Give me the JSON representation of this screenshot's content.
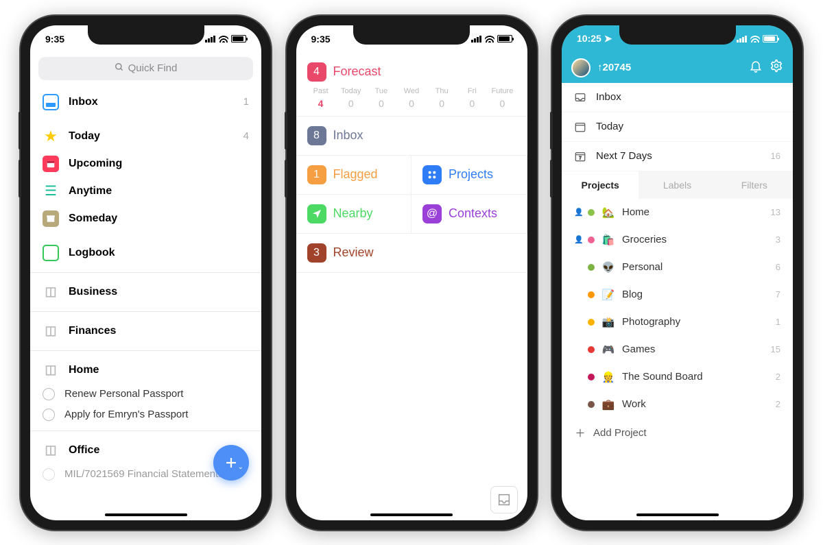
{
  "phone1": {
    "time": "9:35",
    "search_placeholder": "Quick Find",
    "items": [
      {
        "label": "Inbox",
        "count": "1"
      },
      {
        "label": "Today",
        "count": "4"
      },
      {
        "label": "Upcoming",
        "count": ""
      },
      {
        "label": "Anytime",
        "count": ""
      },
      {
        "label": "Someday",
        "count": ""
      },
      {
        "label": "Logbook",
        "count": ""
      }
    ],
    "areas": [
      "Business",
      "Finances",
      "Home",
      "Office"
    ],
    "tasks": [
      "Renew Personal Passport",
      "Apply for Emryn's Passport"
    ],
    "cutoff_task": "MIL/7021569 Financial Statements"
  },
  "phone2": {
    "time": "9:35",
    "forecast": {
      "badge": "4",
      "label": "Forecast",
      "color": "#e9486a"
    },
    "days": [
      {
        "h": "Past",
        "v": "4",
        "active": true
      },
      {
        "h": "Today",
        "v": "0"
      },
      {
        "h": "Tue",
        "v": "0"
      },
      {
        "h": "Wed",
        "v": "0"
      },
      {
        "h": "Thu",
        "v": "0"
      },
      {
        "h": "Fri",
        "v": "0"
      },
      {
        "h": "Future",
        "v": "0"
      }
    ],
    "inbox": {
      "badge": "8",
      "label": "Inbox",
      "badge_color": "#6d7896",
      "text_color": "#6d7896"
    },
    "flagged": {
      "badge": "1",
      "label": "Flagged",
      "badge_color": "#f59e42",
      "text_color": "#f59e42"
    },
    "projects": {
      "label": "Projects",
      "badge_color": "#2e7cf6",
      "text_color": "#2e7cf6"
    },
    "nearby": {
      "label": "Nearby",
      "badge_color": "#4cd964",
      "text_color": "#4cd964"
    },
    "contexts": {
      "label": "Contexts",
      "badge_color": "#9b3fd9",
      "text_color": "#9b3fd9"
    },
    "review": {
      "badge": "3",
      "label": "Review",
      "badge_color": "#a0432a",
      "text_color": "#a0432a"
    }
  },
  "phone3": {
    "time": "10:25",
    "karma": "20745",
    "smart": [
      {
        "label": "Inbox",
        "count": ""
      },
      {
        "label": "Today",
        "count": ""
      },
      {
        "label": "Next 7 Days",
        "count": "16"
      }
    ],
    "tabs": [
      "Projects",
      "Labels",
      "Filters"
    ],
    "projects": [
      {
        "emoji": "🏡",
        "label": "Home",
        "count": "13",
        "dot": "#8bc34a",
        "shared": true
      },
      {
        "emoji": "🛍️",
        "label": "Groceries",
        "count": "3",
        "dot": "#f06292",
        "shared": true
      },
      {
        "emoji": "👽",
        "label": "Personal",
        "count": "6",
        "dot": "#7cb342",
        "shared": false
      },
      {
        "emoji": "📝",
        "label": "Blog",
        "count": "7",
        "dot": "#ff9800",
        "shared": false
      },
      {
        "emoji": "📸",
        "label": "Photography",
        "count": "1",
        "dot": "#ffb300",
        "shared": false
      },
      {
        "emoji": "🎮",
        "label": "Games",
        "count": "15",
        "dot": "#e53935",
        "shared": false
      },
      {
        "emoji": "👷",
        "label": "The Sound Board",
        "count": "2",
        "dot": "#c2185b",
        "shared": false
      },
      {
        "emoji": "💼",
        "label": "Work",
        "count": "2",
        "dot": "#795548",
        "shared": false
      }
    ],
    "add_project": "Add Project"
  }
}
